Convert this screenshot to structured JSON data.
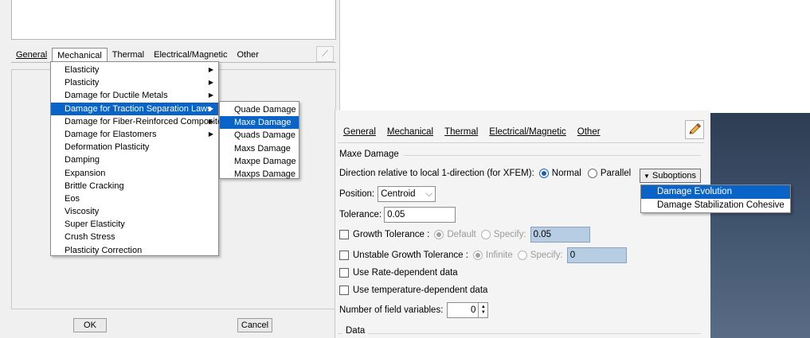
{
  "left_dialog": {
    "tabs": [
      "General",
      "Mechanical",
      "Thermal",
      "Electrical/Magnetic",
      "Other"
    ],
    "ok_label": "OK",
    "cancel_label": "Cancel"
  },
  "mechanical_menu": {
    "items": [
      {
        "label": "Elasticity",
        "submenu": true
      },
      {
        "label": "Plasticity",
        "submenu": true
      },
      {
        "label": "Damage for Ductile Metals",
        "submenu": true
      },
      {
        "label": "Damage for Traction Separation Laws",
        "submenu": true,
        "highlighted": true
      },
      {
        "label": "Damage for Fiber-Reinforced Composites",
        "submenu": true
      },
      {
        "label": "Damage for Elastomers",
        "submenu": true
      },
      {
        "label": "Deformation Plasticity"
      },
      {
        "label": "Damping"
      },
      {
        "label": "Expansion"
      },
      {
        "label": "Brittle Cracking"
      },
      {
        "label": "Eos"
      },
      {
        "label": "Viscosity"
      },
      {
        "label": "Super Elasticity"
      },
      {
        "label": "Crush Stress"
      },
      {
        "label": "Plasticity Correction"
      }
    ]
  },
  "traction_submenu": {
    "items": [
      {
        "label": "Quade Damage"
      },
      {
        "label": "Maxe Damage",
        "highlighted": true
      },
      {
        "label": "Quads Damage"
      },
      {
        "label": "Maxs Damage"
      },
      {
        "label": "Maxpe Damage"
      },
      {
        "label": "Maxps Damage"
      }
    ]
  },
  "right_dialog": {
    "tabs": [
      "General",
      "Mechanical",
      "Thermal",
      "Electrical/Magnetic",
      "Other"
    ],
    "group_title": "Maxe Damage",
    "direction_label": "Direction relative to local 1-direction (for XFEM):",
    "direction_options": [
      "Normal",
      "Parallel"
    ],
    "direction_selected": "Normal",
    "suboptions_label": "Suboptions",
    "suboptions_items": [
      "Damage Evolution",
      "Damage Stabilization Cohesive"
    ],
    "position_label": "Position:",
    "position_value": "Centroid",
    "tolerance_label": "Tolerance:",
    "tolerance_value": "0.05",
    "growth_tolerance_label": "Growth Tolerance :",
    "growth_options": [
      "Default",
      "Specify:"
    ],
    "growth_value": "0.05",
    "unstable_label": "Unstable Growth Tolerance :",
    "unstable_options": [
      "Infinite",
      "Specify:"
    ],
    "unstable_value": "0",
    "rate_label": "Use Rate-dependent data",
    "temp_label": "Use temperature-dependent data",
    "field_vars_label": "Number of field variables:",
    "field_vars_value": "0",
    "data_title": "Data"
  },
  "colors": {
    "highlight": "#0a64c8",
    "radio_selected": "#1a5fb4",
    "disabled_field": "#b7cde4"
  }
}
